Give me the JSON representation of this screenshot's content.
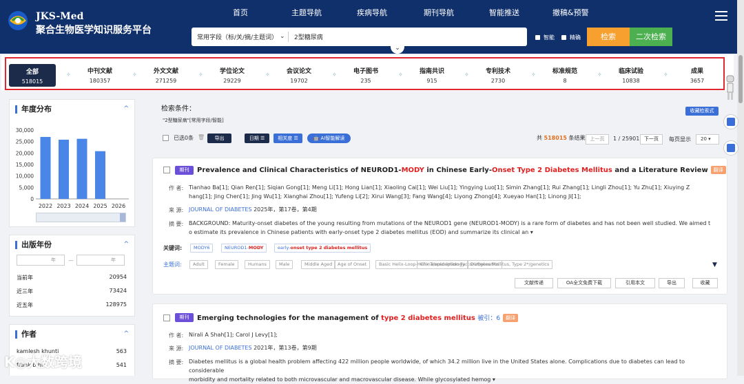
{
  "header": {
    "logo_line1": "JKS-Med",
    "logo_line2": "聚合生物医学知识服务平台",
    "nav": [
      "首页",
      "主题导航",
      "疾病导航",
      "期刊导航",
      "智能推送",
      "撤稿&预警"
    ],
    "search_field": "常用字段（标/关/摘/主题词）",
    "search_value": "2型糖尿病",
    "chk_smart": "智能",
    "chk_exact": "精确",
    "search_btn": "检索",
    "second_search_btn": "二次检索"
  },
  "categories": [
    {
      "name": "全部",
      "count": "518015"
    },
    {
      "name": "中刊文献",
      "count": "180357"
    },
    {
      "name": "外文文献",
      "count": "271259"
    },
    {
      "name": "学位论文",
      "count": "29229"
    },
    {
      "name": "会议论文",
      "count": "19702"
    },
    {
      "name": "电子图书",
      "count": "235"
    },
    {
      "name": "指南共识",
      "count": "915"
    },
    {
      "name": "专利技术",
      "count": "2730"
    },
    {
      "name": "标准规范",
      "count": "8"
    },
    {
      "name": "临床试验",
      "count": "10838"
    },
    {
      "name": "成果",
      "count": "3657"
    }
  ],
  "sidebar": {
    "year_dist_title": "年度分布",
    "pub_year_title": "出版年份",
    "date_from_placeholder": "年",
    "date_to_placeholder": "年",
    "year_rows": [
      {
        "label": "当前年",
        "value": "20954"
      },
      {
        "label": "近三年",
        "value": "73424"
      },
      {
        "label": "近五年",
        "value": "128975"
      }
    ],
    "authors_title": "作者",
    "authors": [
      {
        "name": "kamlesh khunti",
        "value": "563"
      },
      {
        "name": "frank b hu",
        "value": "541"
      }
    ]
  },
  "chart_data": {
    "type": "bar",
    "categories": [
      "2022",
      "2023",
      "2024",
      "2025",
      "2026"
    ],
    "values": [
      27000,
      25800,
      26200,
      20800,
      0
    ],
    "yticks": [
      "0",
      "5,000",
      "10,000",
      "15,000",
      "20,000",
      "25,000",
      "30,000"
    ],
    "ylim": [
      0,
      30000
    ],
    "color": "#4a86e8"
  },
  "results": {
    "cond_title": "检索条件：",
    "cond_text": "\"2型糖尿病\"[常用字段/智能]",
    "fav_btn": "收藏检索式",
    "selected": "已选0条",
    "export": "导出",
    "sort_date": "日期",
    "sort_rel": "相关度",
    "ai": "AI智能解读",
    "total_prefix": "共",
    "total": "518015",
    "total_suffix": "条结果。",
    "prev": "上一页",
    "page": "1 / 25901",
    "next": "下一页",
    "per_page_label": "每页显示",
    "per_page": "20"
  },
  "items": [
    {
      "type": "期刊",
      "title_a": "Prevalence and Clinical Characteristics of NEUROD1-",
      "title_b": "MODY",
      "title_c": " in Chinese Early-",
      "title_d": "Onset Type 2 Diabetes Mellitus",
      "title_e": " and a Literature Review",
      "fanyi": "翻译",
      "author_lbl": "作 者:",
      "authors1": "Tianhao Ba[1]; Qian Ren[1]; Siqian Gong[1]; Meng Li[1]; Hong Lian[1]; Xiaoling Cai[1]; Wei Liu[1]; Yingying Luo[1]; Simin Zhang[1]; Rui Zhang[1]; Lingli Zhou[1]; Yu Zhu[1]; Xiuying Z",
      "authors2": "hang[1]; Jing Chen[1]; Jing Wu[1]; Xianghai Zhou[1]; Yufeng Li[2]; Xirui Wang[3]; Fang Wang[4]; Liyong Zhong[4]; Xueyao Han[1]; Linong Ji[1];",
      "src_lbl": "来 源:",
      "src_journal": "JOURNAL OF DIABETES",
      "src_info": " 2025年，第17卷，第4期",
      "abs_lbl": "摘 要:",
      "abs1": "BACKGROUND: Maturity-onset diabetes of the young resulting from mutations of the NEUROD1 gene (NEUROD1-MODY) is a rare form of diabetes and has not been well studied. We aimed t",
      "abs2": "o estimate its prevalence in Chinese patients with early-onset type 2 diabetes mellitus (EOD) and summarize its clinical an",
      "kw_lbl": "关键词:",
      "kw1": "MODY6",
      "kw2a": "NEUROD1-",
      "kw2b": "MODY",
      "kw3a": "early-",
      "kw3b": "onset type 2 diabetes mellitus",
      "mesh_lbl": "主题词:",
      "mesh": [
        "Adult",
        "Female",
        "Humans",
        "Male",
        "Middle Aged",
        "Age of Onset",
        "Basic Helix-Loop-Helix Transcription Factors*/genetics",
        "China/epidemiology",
        "Diabetes Mellitus, Type 2*/genetics"
      ],
      "actions": [
        "文献传递",
        "OA全文免费下载",
        "引用本文",
        "导出",
        "收藏"
      ]
    },
    {
      "type": "期刊",
      "title_a": "Emerging technologies for the management of ",
      "title_b": "type 2 diabetes mellitus",
      "cite": "被引：6",
      "fanyi": "翻译",
      "author_lbl": "作 者:",
      "authors1": "Nirali A Shah[1]; Carol J Levy[1];",
      "src_lbl": "来 源:",
      "src_journal": "JOURNAL OF DIABETES",
      "src_info": " 2021年，第13卷，第9期",
      "abs_lbl": "摘 要:",
      "abs1": "Diabetes mellitus is a global health problem affecting 422 million people worldwide, of which 34.2 million live in the United States alone. Complications due to diabetes can lead to considerable",
      "abs2": "morbidity and mortality related to both microvascular and macrovascular disease. While glycosylated hemog"
    }
  ],
  "watermark": "K◎大数跨境"
}
